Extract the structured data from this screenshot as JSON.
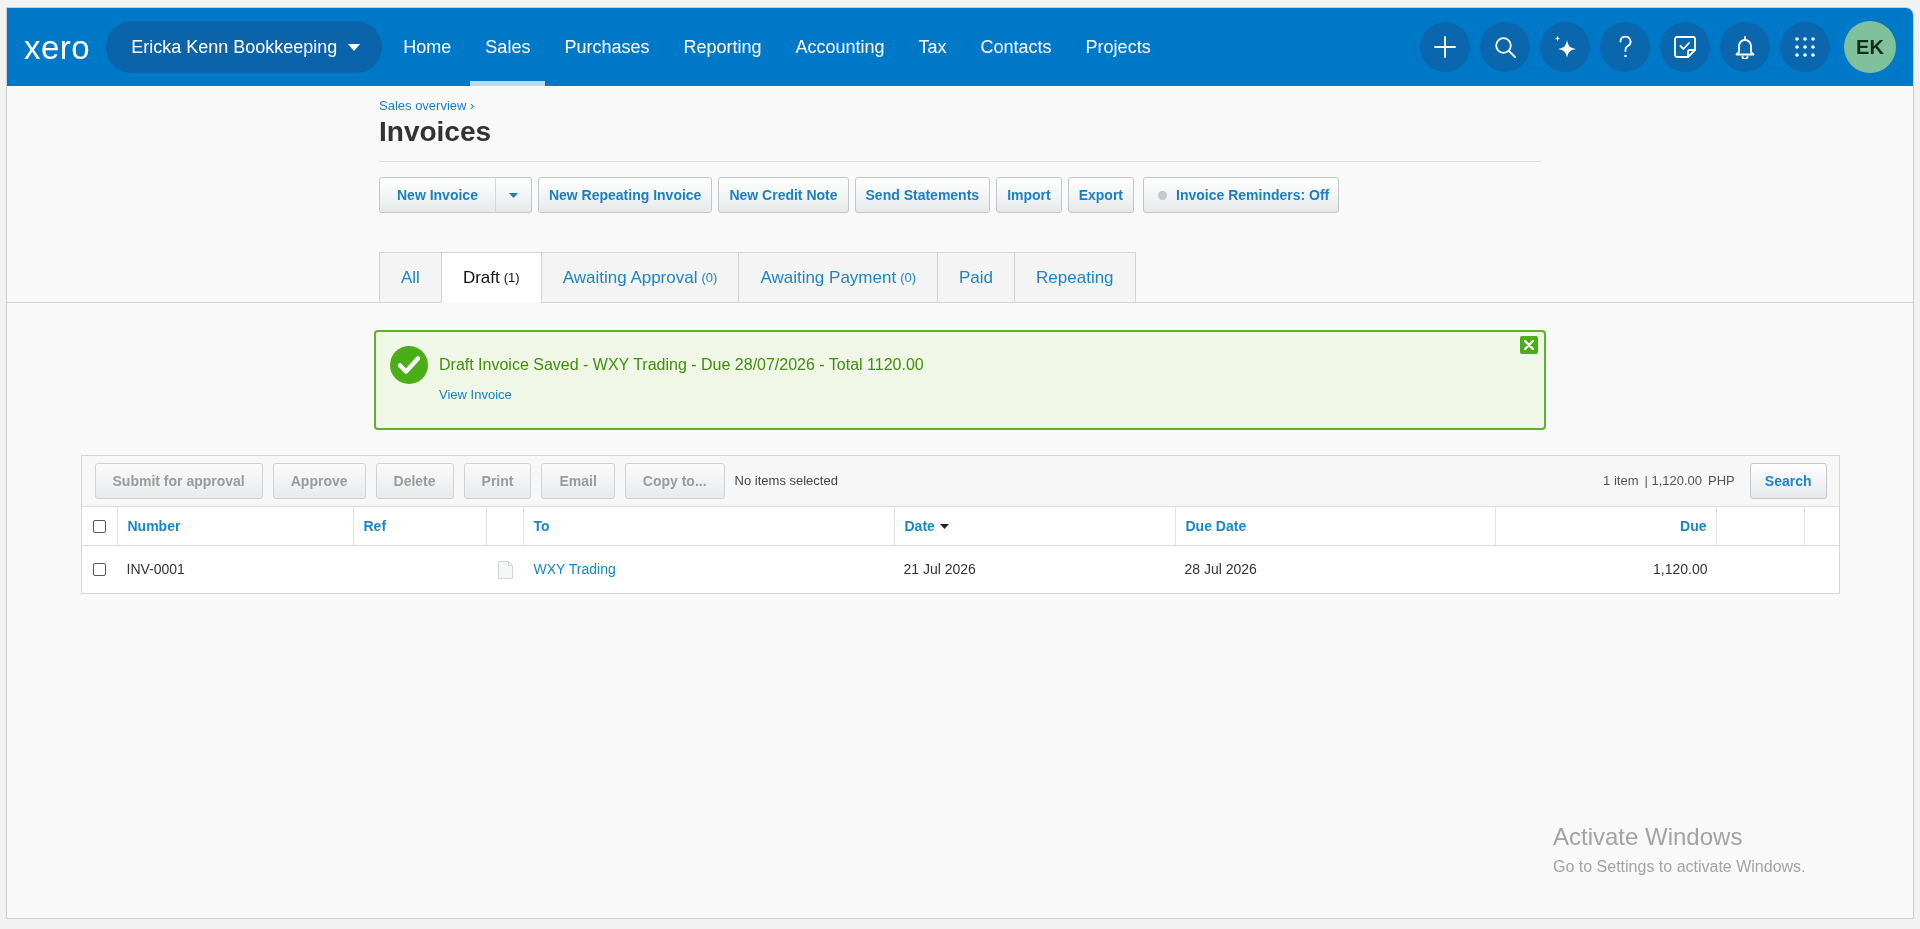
{
  "nav": {
    "logo": "xero",
    "organisation": "Ericka Kenn Bookkeeping",
    "menu": [
      {
        "label": "Home",
        "selected": false
      },
      {
        "label": "Sales",
        "selected": true
      },
      {
        "label": "Purchases",
        "selected": false
      },
      {
        "label": "Reporting",
        "selected": false
      },
      {
        "label": "Accounting",
        "selected": false
      },
      {
        "label": "Tax",
        "selected": false
      },
      {
        "label": "Contacts",
        "selected": false
      },
      {
        "label": "Projects",
        "selected": false
      }
    ],
    "avatar": "EK"
  },
  "header": {
    "breadcrumb": "Sales overview ›",
    "title": "Invoices"
  },
  "actions": [
    {
      "kind": "split",
      "label": "New Invoice"
    },
    {
      "kind": "plain",
      "label": "New Repeating Invoice"
    },
    {
      "kind": "plain",
      "label": "New Credit Note"
    },
    {
      "kind": "plain",
      "label": "Send Statements"
    },
    {
      "kind": "plain",
      "label": "Import"
    },
    {
      "kind": "plain",
      "label": "Export"
    },
    {
      "kind": "status",
      "label": "Invoice Reminders: Off",
      "on": false
    }
  ],
  "tabs": [
    {
      "label": "All",
      "selected": false
    },
    {
      "label": "Draft",
      "count": "(1)",
      "selected": true
    },
    {
      "label": "Awaiting Approval",
      "count": "(0)",
      "selected": false
    },
    {
      "label": "Awaiting Payment",
      "count": "(0)",
      "selected": false
    },
    {
      "label": "Paid",
      "selected": false
    },
    {
      "label": "Repeating",
      "selected": false
    }
  ],
  "notification": {
    "message": "Draft Invoice Saved - WXY Trading - Due 28/07/2026 - Total 1120.00",
    "link": "View Invoice"
  },
  "table_toolbar": {
    "buttons": [
      {
        "label": "Submit for approval",
        "disabled": true
      },
      {
        "label": "Approve",
        "disabled": true
      },
      {
        "label": "Delete",
        "disabled": true
      },
      {
        "label": "Print",
        "disabled": true
      },
      {
        "label": "Email",
        "disabled": true
      },
      {
        "label": "Copy to...",
        "disabled": true
      }
    ],
    "selection_status": "No items selected",
    "item_count": "1 item",
    "total": "| 1,120.00",
    "currency": "PHP",
    "search_button": "Search"
  },
  "table": {
    "columns": [
      {
        "kind": "select",
        "checked": false
      },
      {
        "kind": "text",
        "label": "Number",
        "sorted": false
      },
      {
        "kind": "text",
        "label": "Ref",
        "sorted": false
      },
      {
        "kind": "attachment"
      },
      {
        "kind": "text",
        "label": "To",
        "sorted": false
      },
      {
        "kind": "text",
        "label": "Date",
        "sorted": true
      },
      {
        "kind": "text",
        "label": "Due Date",
        "sorted": false
      },
      {
        "kind": "amount",
        "label": "Due",
        "sorted": false
      },
      {
        "kind": "blank"
      },
      {
        "kind": "blank"
      }
    ],
    "rows": [
      {
        "checked": false,
        "number": "INV-0001",
        "to": "WXY Trading",
        "date": "21 Jul 2026",
        "due_date": "28 Jul 2026",
        "due": "1,120.00"
      }
    ]
  },
  "windows_notice": {
    "title": "Activate Windows",
    "hint": "Go to Settings to activate Windows."
  }
}
